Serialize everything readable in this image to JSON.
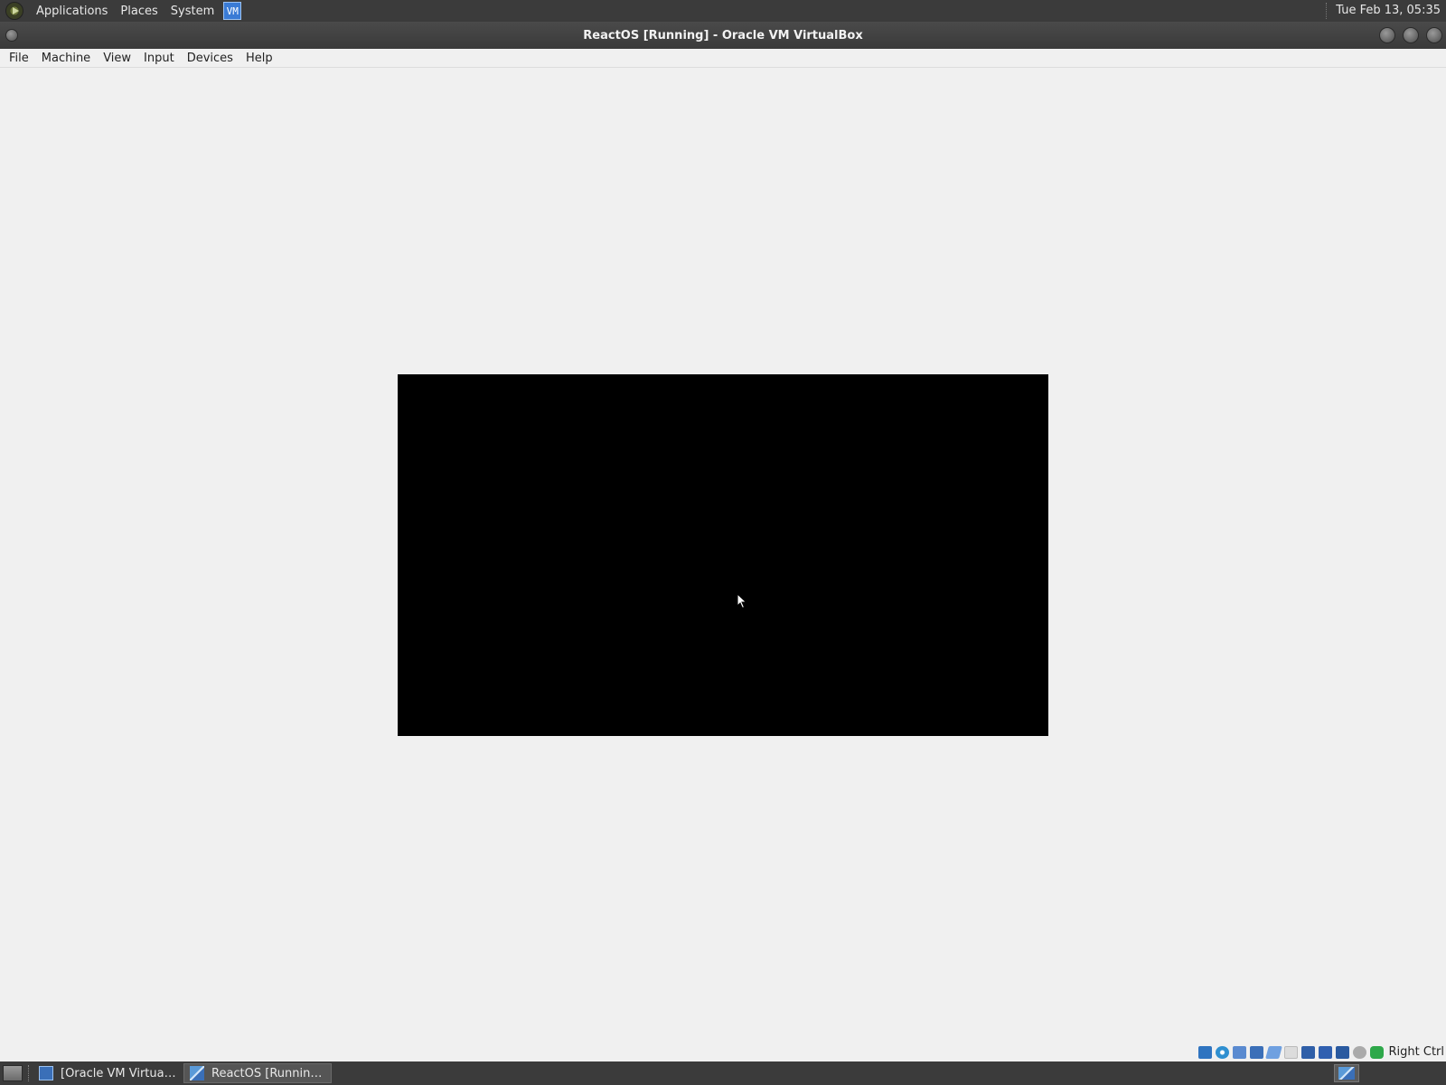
{
  "top_panel": {
    "menus": [
      "Applications",
      "Places",
      "System"
    ],
    "launcher_icon": "virtualbox-icon",
    "clock": "Tue Feb 13, 05:35"
  },
  "window": {
    "title": "ReactOS [Running] - Oracle VM VirtualBox"
  },
  "menu_bar": {
    "items": [
      "File",
      "Machine",
      "View",
      "Input",
      "Devices",
      "Help"
    ]
  },
  "vm_display": {
    "screen_color": "#000000",
    "background_color": "#f0f0f0"
  },
  "status_bar": {
    "icons": [
      "hard-disk-icon",
      "optical-drive-icon",
      "audio-icon",
      "network-icon",
      "usb-icon",
      "shared-folders-icon",
      "display-icon",
      "recording-icon",
      "cpu-icon",
      "mouse-integration-icon",
      "keyboard-icon"
    ],
    "host_key": "Right Ctrl"
  },
  "taskbar": {
    "tasks": [
      {
        "label": "[Oracle VM VirtualB...",
        "icon": "virtualbox-icon",
        "active": false
      },
      {
        "label": "ReactOS [Running] -...",
        "icon": "reactos-icon",
        "active": true
      }
    ]
  },
  "colors": {
    "panel_bg": "#3b3b3b",
    "window_bg": "#f0f0f0",
    "accent": "#3a7bd5"
  }
}
